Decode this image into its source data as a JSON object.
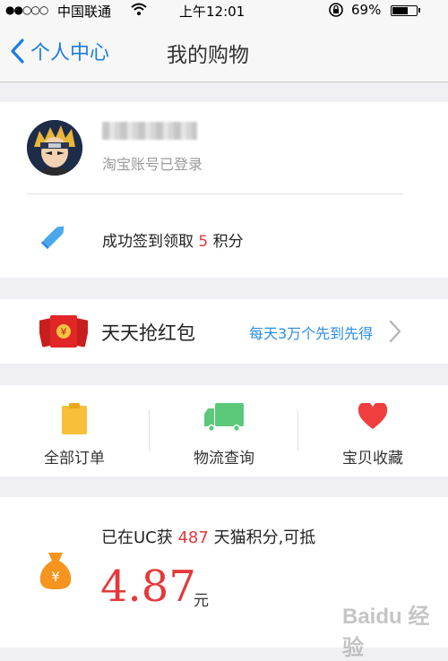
{
  "status_bar": {
    "signal": "●●○○○",
    "carrier": "中国联通",
    "time": "上午12:01",
    "battery_percent": "69%",
    "battery_level": 0.69
  },
  "nav": {
    "back_label": "个人中心",
    "title": "我的购物"
  },
  "account": {
    "login_status": "淘宝账号已登录",
    "checkin_prefix": "成功签到领取",
    "checkin_points": "5",
    "checkin_suffix": "积分"
  },
  "red_packet": {
    "title": "天天抢红包",
    "subtitle": "每天3万个先到先得"
  },
  "shortcuts": {
    "all_orders": "全部订单",
    "logistics": "物流查询",
    "favorites": "宝贝收藏"
  },
  "points": {
    "prefix": "已在UC获",
    "count": "487",
    "suffix": "天猫积分,可抵",
    "amount": "4.87",
    "unit": "元"
  },
  "watermark": "Baidu 经验",
  "colors": {
    "accent_blue": "#1a7ee0",
    "highlight_red": "#e4393c",
    "order_yellow": "#f7c03a",
    "truck_green": "#5cc97a",
    "heart_red": "#ee3e3e",
    "moneybag_orange": "#f5941e"
  }
}
